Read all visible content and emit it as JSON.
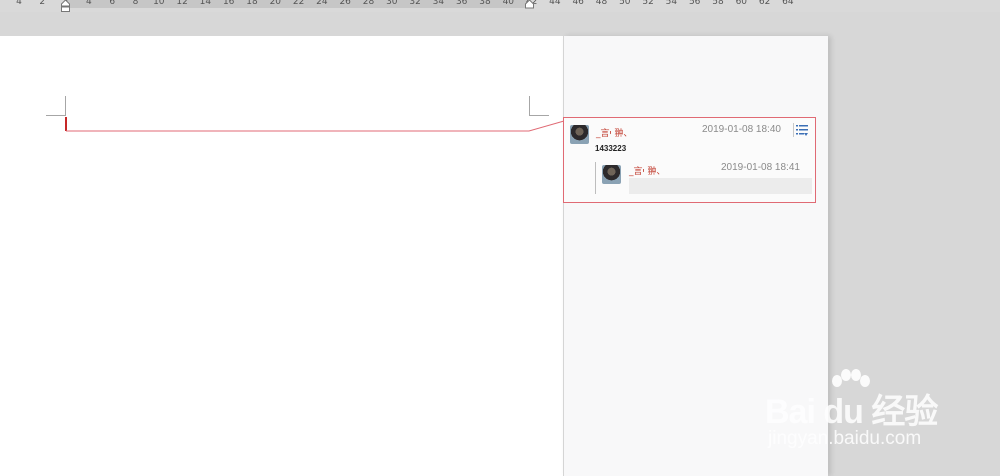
{
  "ruler": {
    "ticks": [
      "4",
      "2",
      "2",
      "4",
      "6",
      "8",
      "10",
      "12",
      "14",
      "16",
      "18",
      "20",
      "22",
      "24",
      "26",
      "28",
      "30",
      "32",
      "34",
      "36",
      "38",
      "40",
      "42",
      "44",
      "46",
      "48",
      "50",
      "52",
      "54",
      "56",
      "58",
      "60",
      "62",
      "64"
    ]
  },
  "comment": {
    "author": "_言י 翀、",
    "time": "2019-01-08 18:40",
    "text": "1433223",
    "menu_icon": "comment-menu-icon",
    "reply": {
      "author": "_言י 翀、",
      "time": "2019-01-08 18:41",
      "input_value": ""
    }
  },
  "colors": {
    "comment_border": "#e06a74",
    "author_name": "#c0392b",
    "menu_icon": "#3b6fb6"
  },
  "watermark": {
    "brand": "Bai du 经验",
    "url": "jingyan.baidu.com"
  }
}
